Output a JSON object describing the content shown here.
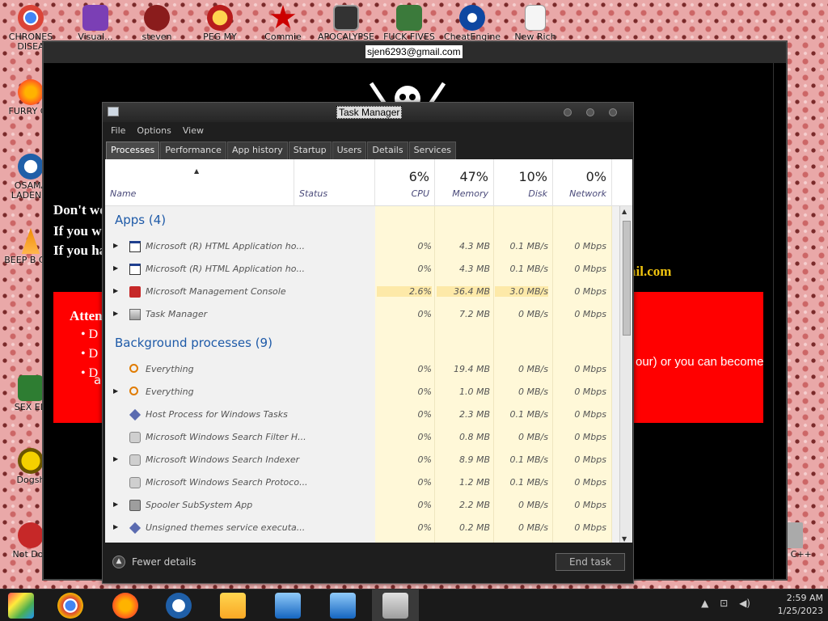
{
  "desktop": {
    "icons": [
      {
        "label": "CHRONES DISEA",
        "color": "#dd4b39"
      },
      {
        "label": "FURRY CU",
        "color": "#ff6d00"
      },
      {
        "label": "OSAMA LADEN B",
        "color": "#1f5fa8"
      },
      {
        "label": "BEEP B CAR",
        "color": "#f08c00"
      },
      {
        "label": "SEX ED",
        "color": "#2e7d32"
      },
      {
        "label": "Dogsh",
        "color": "#c8a200"
      },
      {
        "label": "Not Dog",
        "color": "#c62828"
      },
      {
        "label": "Visual...",
        "color": "#7b3fb5"
      },
      {
        "label": "steven",
        "color": "#8a1c1c"
      },
      {
        "label": "PEG MY WIFE",
        "color": "#b71c1c"
      },
      {
        "label": "Commie",
        "color": "#cc0000"
      },
      {
        "label": "APOCALYPSE",
        "color": "#333333"
      },
      {
        "label": "FUCK FIVES",
        "color": "#3b7a3b"
      },
      {
        "label": "CheatEngine",
        "color": "#0d47a1"
      },
      {
        "label": "New Rich Text",
        "color": "#e0e0e0"
      },
      {
        "label": "un C++",
        "color": "#888888"
      }
    ]
  },
  "browser": {
    "title": "sjen6293@gmail.com",
    "lines": [
      "Don't wo",
      "If you w",
      "If you ha"
    ],
    "mail_tail": "ail.com",
    "red_box": {
      "title": "Atten",
      "bullets": [
        "D",
        "D",
        "D"
      ],
      "tail": "our) or you can become",
      "tail2": "a"
    }
  },
  "task_manager": {
    "title": "Task Manager",
    "menu": [
      "File",
      "Options",
      "View"
    ],
    "tabs": [
      "Processes",
      "Performance",
      "App history",
      "Startup",
      "Users",
      "Details",
      "Services"
    ],
    "active_tab": "Processes",
    "columns": {
      "name": "Name",
      "status": "Status",
      "cpu": {
        "pct": "6%",
        "label": "CPU"
      },
      "memory": {
        "pct": "47%",
        "label": "Memory"
      },
      "disk": {
        "pct": "10%",
        "label": "Disk"
      },
      "network": {
        "pct": "0%",
        "label": "Network"
      }
    },
    "groups": {
      "apps": {
        "title": "Apps (4)",
        "rows": [
          {
            "name": "Microsoft (R) HTML Application ho...",
            "cpu": "0%",
            "mem": "4.3 MB",
            "disk": "0.1 MB/s",
            "net": "0 Mbps",
            "expandable": true,
            "icon": "window-icon"
          },
          {
            "name": "Microsoft (R) HTML Application ho...",
            "cpu": "0%",
            "mem": "4.3 MB",
            "disk": "0.1 MB/s",
            "net": "0 Mbps",
            "expandable": true,
            "icon": "window-icon"
          },
          {
            "name": "Microsoft Management Console",
            "cpu": "2.6%",
            "mem": "36.4 MB",
            "disk": "3.0 MB/s",
            "net": "0 Mbps",
            "expandable": true,
            "icon": "console-icon"
          },
          {
            "name": "Task Manager",
            "cpu": "0%",
            "mem": "7.2 MB",
            "disk": "0 MB/s",
            "net": "0 Mbps",
            "expandable": true,
            "icon": "task-manager-icon"
          }
        ]
      },
      "background": {
        "title": "Background processes (9)",
        "rows": [
          {
            "name": "Everything",
            "cpu": "0%",
            "mem": "19.4 MB",
            "disk": "0 MB/s",
            "net": "0 Mbps",
            "expandable": false,
            "icon": "magnifier-icon"
          },
          {
            "name": "Everything",
            "cpu": "0%",
            "mem": "1.0 MB",
            "disk": "0 MB/s",
            "net": "0 Mbps",
            "expandable": true,
            "icon": "magnifier-icon"
          },
          {
            "name": "Host Process for Windows Tasks",
            "cpu": "0%",
            "mem": "2.3 MB",
            "disk": "0.1 MB/s",
            "net": "0 Mbps",
            "expandable": false,
            "icon": "diamond-icon"
          },
          {
            "name": "Microsoft Windows Search Filter H...",
            "cpu": "0%",
            "mem": "0.8 MB",
            "disk": "0 MB/s",
            "net": "0 Mbps",
            "expandable": false,
            "icon": "search-service-icon"
          },
          {
            "name": "Microsoft Windows Search Indexer",
            "cpu": "0%",
            "mem": "8.9 MB",
            "disk": "0.1 MB/s",
            "net": "0 Mbps",
            "expandable": true,
            "icon": "search-service-icon"
          },
          {
            "name": "Microsoft Windows Search Protoco...",
            "cpu": "0%",
            "mem": "1.2 MB",
            "disk": "0.1 MB/s",
            "net": "0 Mbps",
            "expandable": false,
            "icon": "search-service-icon"
          },
          {
            "name": "Spooler SubSystem App",
            "cpu": "0%",
            "mem": "2.2 MB",
            "disk": "0 MB/s",
            "net": "0 Mbps",
            "expandable": true,
            "icon": "printer-icon"
          },
          {
            "name": "Unsigned themes service executa...",
            "cpu": "0%",
            "mem": "0.2 MB",
            "disk": "0 MB/s",
            "net": "0 Mbps",
            "expandable": true,
            "icon": "diamond-icon"
          }
        ]
      }
    },
    "footer": {
      "fewer_details": "Fewer details",
      "end_task": "End task"
    }
  },
  "taskbar": {
    "items": [
      "photos-icon",
      "chrome-icon",
      "firefox-icon",
      "obama-icon",
      "file-explorer-icon",
      "remote-app-icon",
      "remote-app-icon-2",
      "task-manager-icon"
    ],
    "time": "2:59 AM",
    "date": "1/25/2023"
  }
}
